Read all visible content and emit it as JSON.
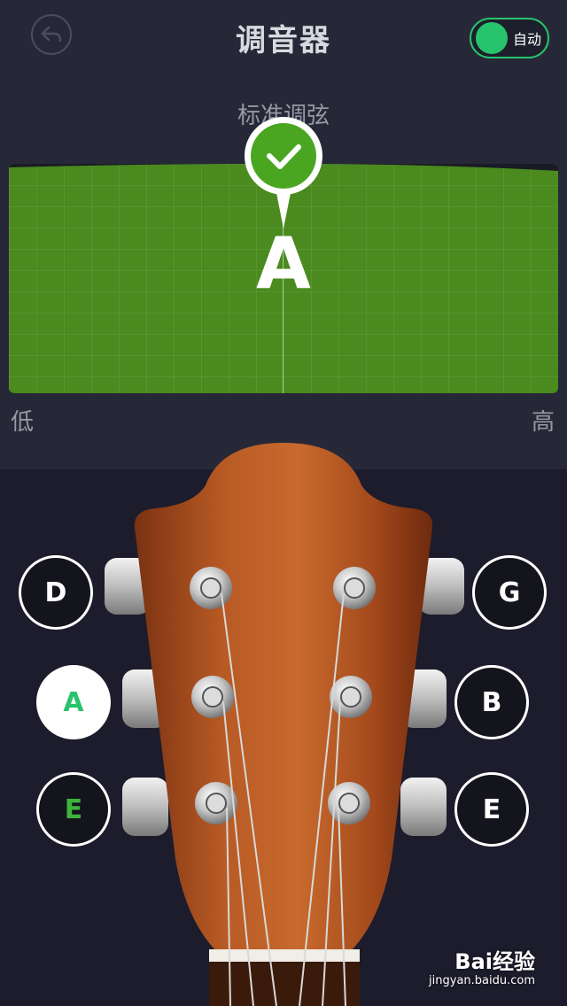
{
  "header": {
    "title": "调音器",
    "auto_label": "自动",
    "back_icon": "back-arrow-icon"
  },
  "tuner": {
    "mode": "标准调弦",
    "current_note": "A",
    "status_icon": "check-icon",
    "low_label": "低",
    "high_label": "高",
    "accent_color": "#4a8a1e"
  },
  "strings": {
    "left": [
      {
        "note": "D"
      },
      {
        "note": "A"
      },
      {
        "note": "E"
      }
    ],
    "right": [
      {
        "note": "G"
      },
      {
        "note": "B"
      },
      {
        "note": "E"
      }
    ]
  },
  "watermark": {
    "brand": "Bai经验",
    "url": "jingyan.baidu.com"
  }
}
